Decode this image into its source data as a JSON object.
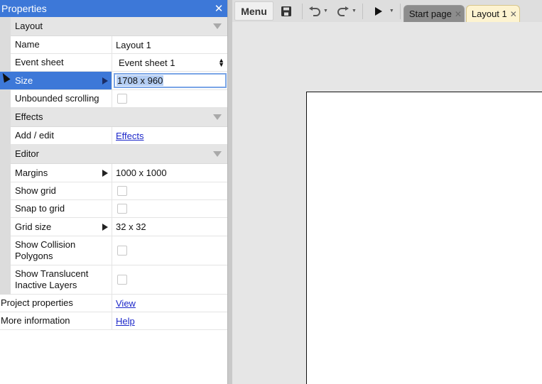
{
  "properties": {
    "title": "Properties",
    "sections": {
      "layout": "Layout",
      "effects": "Effects",
      "editor": "Editor"
    },
    "rows": {
      "name": {
        "label": "Name",
        "value": "Layout 1"
      },
      "event_sheet": {
        "label": "Event sheet",
        "value": "Event sheet 1"
      },
      "size": {
        "label": "Size",
        "value": "1708 x 960"
      },
      "unbounded_scrolling": {
        "label": "Unbounded scrolling",
        "checked": false
      },
      "add_edit": {
        "label": "Add / edit",
        "value": "Effects"
      },
      "margins": {
        "label": "Margins",
        "value": "1000 x 1000"
      },
      "show_grid": {
        "label": "Show grid",
        "checked": false
      },
      "snap_to_grid": {
        "label": "Snap to grid",
        "checked": false
      },
      "grid_size": {
        "label": "Grid size",
        "value": "32 x 32"
      },
      "show_collision": {
        "label": "Show Collision Polygons",
        "checked": false
      },
      "show_translucent": {
        "label": "Show Translucent Inactive Layers",
        "checked": false
      },
      "project_properties": {
        "label": "Project properties",
        "value": "View"
      },
      "more_information": {
        "label": "More information",
        "value": "Help"
      }
    }
  },
  "toolbar": {
    "menu_label": "Menu",
    "tabs": [
      {
        "label": "Start page",
        "active": false
      },
      {
        "label": "Layout 1",
        "active": true
      }
    ]
  },
  "colors": {
    "accent": "#3d78d8",
    "link": "#1c27c9",
    "active_tab": "#fdf3d0",
    "inactive_tab": "#8d8d8d"
  }
}
